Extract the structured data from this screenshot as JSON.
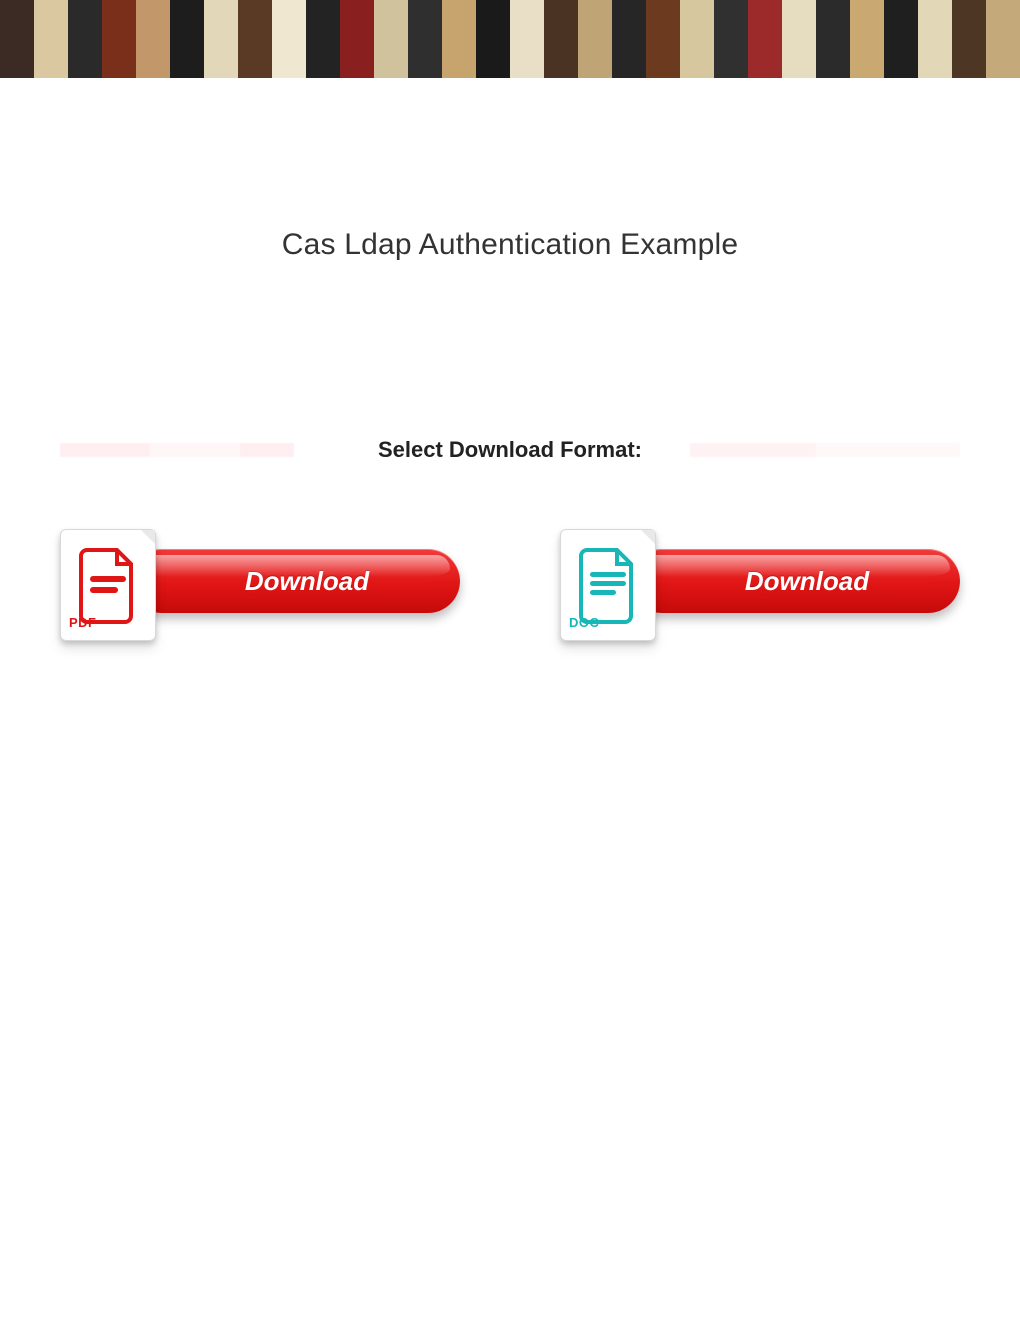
{
  "banner": {
    "tiles": [
      "#3b2b24",
      "#d9c8a0",
      "#2a2a2a",
      "#7a2f1a",
      "#c2986a",
      "#1d1d1d",
      "#e3d7b9",
      "#5a3a24",
      "#efe7d0",
      "#232323",
      "#8a1f1f",
      "#d0c29c",
      "#2f2f2f",
      "#c7a36e",
      "#1a1a1a",
      "#e8dfc6",
      "#4a3322",
      "#bfa576",
      "#262626",
      "#6b3a1f",
      "#d6c79f",
      "#303030",
      "#9c2a2a",
      "#e6dcc0",
      "#2b2b2b",
      "#c9a871",
      "#1f1f1f",
      "#e2d7b7",
      "#4d3624",
      "#c4a97a"
    ]
  },
  "page": {
    "title": "Cas Ldap Authentication Example",
    "select_label": "Select Download Format:"
  },
  "buttons": {
    "pdf": {
      "icon_label": "PDF",
      "text": "Download"
    },
    "doc": {
      "icon_label": "DOC",
      "text": "Download"
    }
  }
}
